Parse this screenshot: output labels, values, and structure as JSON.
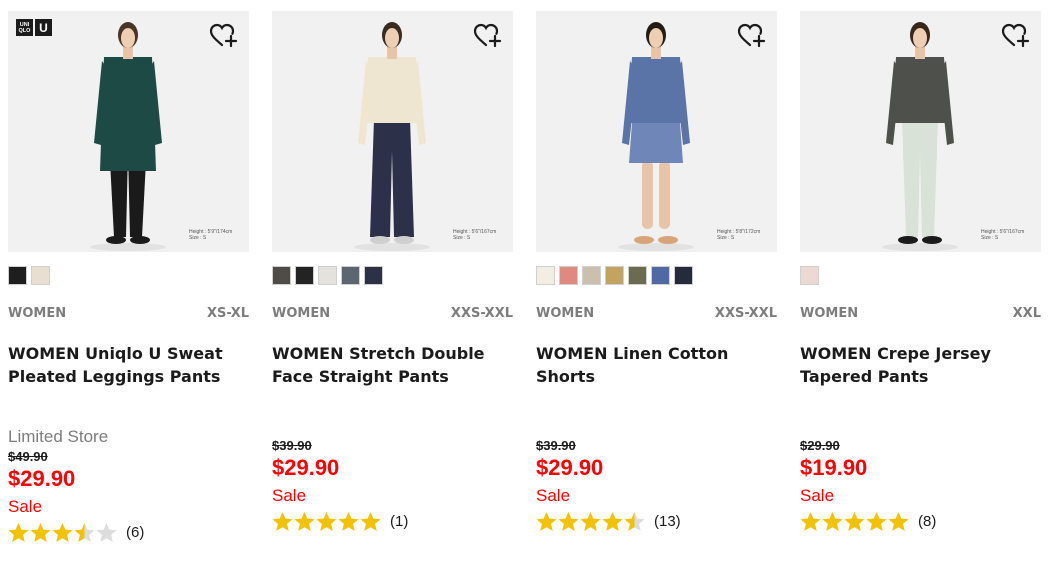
{
  "products": [
    {
      "has_brand_logo": true,
      "brand_logo": {
        "text_small": "UNI QLO",
        "text_u": "U"
      },
      "height_note": [
        "Height : 5'9\"/174cm",
        "Size : S"
      ],
      "swatches": [
        "#1e1e1e",
        "#e9dfd1"
      ],
      "gender": "WOMEN",
      "sizes": "XS-XL",
      "name": "WOMEN Uniqlo U Sweat Pleated Leggings Pants",
      "availability": "Limited Store",
      "original_price": "$49.90",
      "price": "$29.90",
      "sale_label": "Sale",
      "rating": 3.5,
      "review_count": "(6)"
    },
    {
      "has_brand_logo": false,
      "height_note": [
        "Height : 5'6\"/167cm",
        "Size : S"
      ],
      "swatches": [
        "#4f4c48",
        "#232323",
        "#e4e2dc",
        "#5b6670",
        "#2c3146"
      ],
      "gender": "WOMEN",
      "sizes": "XXS-XXL",
      "name": "WOMEN Stretch Double Face Straight Pants",
      "availability": "",
      "original_price": "$39.90",
      "price": "$29.90",
      "sale_label": "Sale",
      "rating": 5,
      "review_count": "(1)"
    },
    {
      "has_brand_logo": false,
      "height_note": [
        "Height : 5'8\"/172cm",
        "Size : S"
      ],
      "swatches": [
        "#f3ede3",
        "#df8a80",
        "#cbbfae",
        "#c2a35f",
        "#6b6b4f",
        "#4f69a4",
        "#262b3c"
      ],
      "gender": "WOMEN",
      "sizes": "XXS-XXL",
      "name": "WOMEN Linen Cotton Shorts",
      "availability": "",
      "original_price": "$39.90",
      "price": "$29.90",
      "sale_label": "Sale",
      "rating": 4.5,
      "review_count": "(13)"
    },
    {
      "has_brand_logo": false,
      "height_note": [
        "Height : 5'6\"/167cm",
        "Size : S"
      ],
      "swatches": [
        "#ecd9d4"
      ],
      "gender": "WOMEN",
      "sizes": "XXL",
      "name": "WOMEN Crepe Jersey Tapered Pants",
      "availability": "",
      "original_price": "$29.90",
      "price": "$19.90",
      "sale_label": "Sale",
      "rating": 5,
      "review_count": "(8)"
    }
  ],
  "models": [
    {
      "top": "#1e4a45",
      "bottom": "#1a1a1a",
      "shoes": "#1a1a1a",
      "hair": "#4a3426",
      "long_top": true
    },
    {
      "top": "#efe6d2",
      "bottom": "#2c3048",
      "shoes": "#cfcfcf",
      "hair": "#3a2a20",
      "long_top": false
    },
    {
      "top": "#5a74a8",
      "bottom": "#6f87b8",
      "shoes": "#d8a47a",
      "hair": "#241b16",
      "long_top": false,
      "shorts": true
    },
    {
      "top": "#4e504b",
      "bottom": "#d9e2d6",
      "shoes": "#1a1a1a",
      "hair": "#3a271c",
      "long_top": false
    }
  ],
  "colors": {
    "sale_red": "#ff0000",
    "star_gold": "#f2c200",
    "star_empty": "#dddddd",
    "muted_text": "#7d7d7d"
  },
  "icons": {
    "wishlist": "heart-plus-icon",
    "rating": "star-icon"
  }
}
